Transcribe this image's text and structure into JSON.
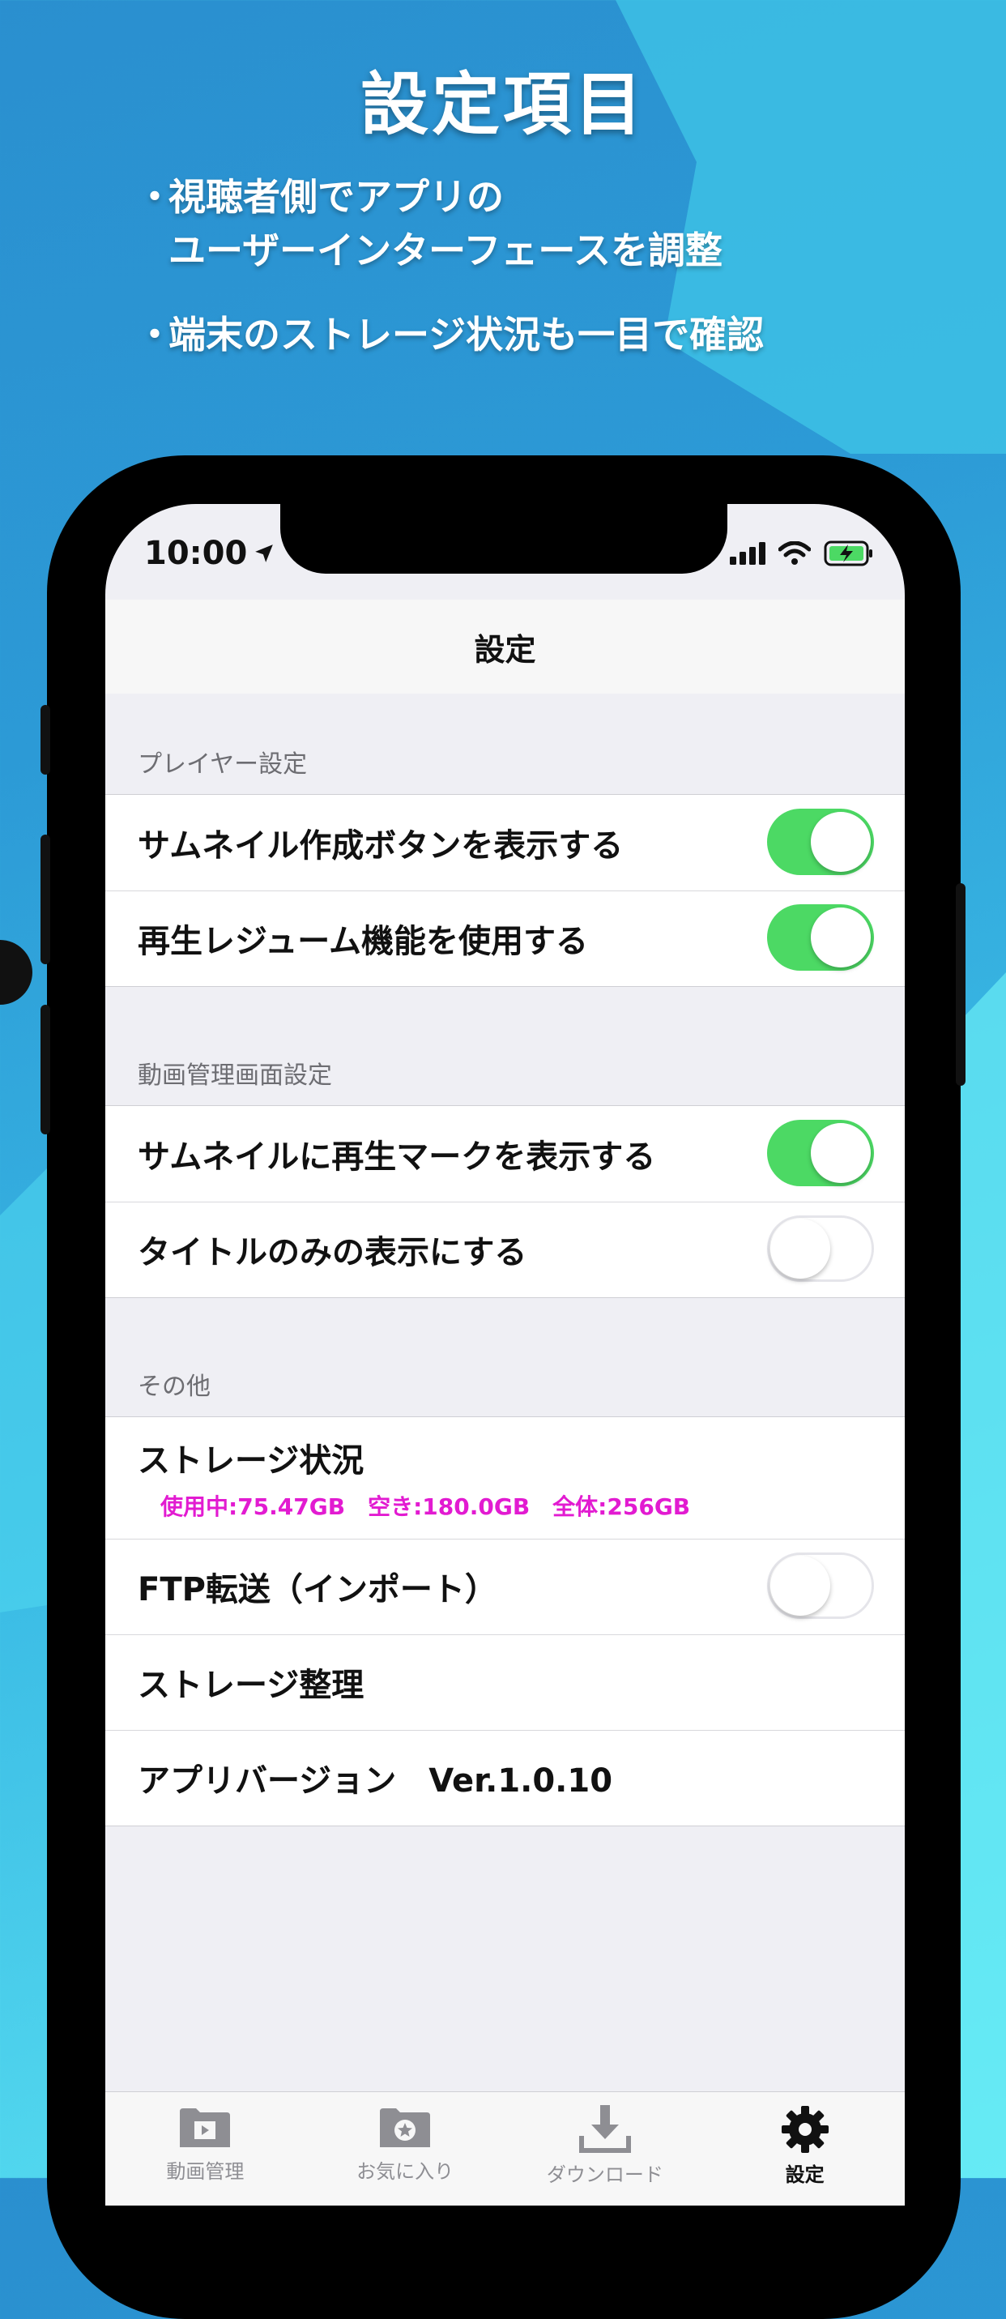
{
  "headline": "設定項目",
  "bullets": [
    {
      "dot": "・",
      "lines": [
        "視聴者側でアプリの",
        "ユーザーインターフェースを調整"
      ]
    },
    {
      "dot": "・",
      "lines": [
        "端末のストレージ状況も一目で確認"
      ]
    }
  ],
  "status_bar": {
    "time": "10:00",
    "icons": [
      "location-arrow-icon",
      "signal-icon",
      "wifi-icon",
      "battery-charging-icon"
    ]
  },
  "nav": {
    "title": "設定"
  },
  "sections": [
    {
      "header": "プレイヤー設定",
      "rows": [
        {
          "label": "サムネイル作成ボタンを表示する",
          "toggle": true
        },
        {
          "label": "再生レジューム機能を使用する",
          "toggle": true
        }
      ]
    },
    {
      "header": "動画管理画面設定",
      "rows": [
        {
          "label": "サムネイルに再生マークを表示する",
          "toggle": true
        },
        {
          "label": "タイトルのみの表示にする",
          "toggle": false
        }
      ]
    },
    {
      "header": "その他",
      "rows": [
        {
          "label": "ストレージ状況",
          "detail": "使用中:75.47GB　空き:180.0GB　全体:256GB"
        },
        {
          "label": "FTP転送（インポート）",
          "toggle": false
        },
        {
          "label": "ストレージ整理"
        },
        {
          "label": "アプリバージョン　Ver.1.0.10"
        }
      ]
    }
  ],
  "tabs": [
    {
      "label": "動画管理",
      "icon": "video-folder-icon",
      "active": false
    },
    {
      "label": "お気に入り",
      "icon": "star-folder-icon",
      "active": false
    },
    {
      "label": "ダウンロード",
      "icon": "download-icon",
      "active": false
    },
    {
      "label": "設定",
      "icon": "gear-icon",
      "active": true
    }
  ],
  "colors": {
    "toggle_on": "#4cd964",
    "storage_text": "#e21bd1",
    "background": "#2c9ad6"
  }
}
